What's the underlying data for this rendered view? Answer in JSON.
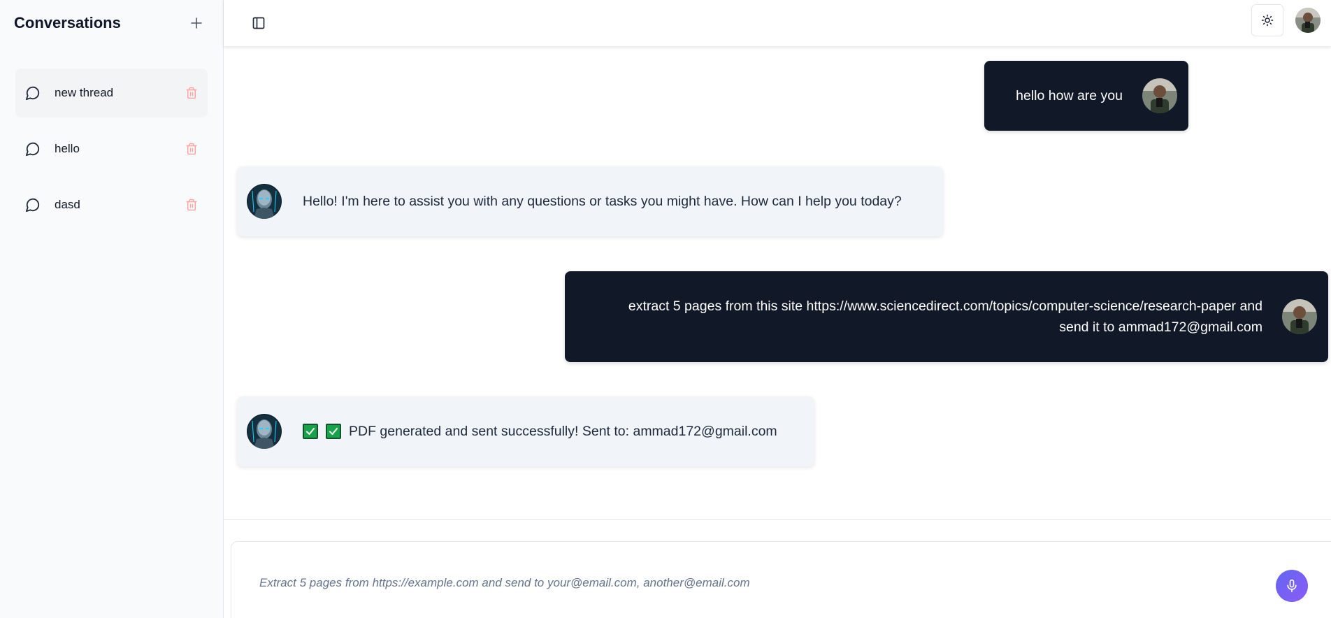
{
  "sidebar": {
    "title": "Conversations",
    "new_icon": "plus-icon",
    "threads": [
      {
        "label": "new thread",
        "icon": "chat-bubble-icon",
        "delete_icon": "trash-icon",
        "active": true
      },
      {
        "label": "hello",
        "icon": "chat-bubble-icon",
        "delete_icon": "trash-icon",
        "active": false
      },
      {
        "label": "dasd",
        "icon": "chat-bubble-icon",
        "delete_icon": "trash-icon",
        "active": false
      }
    ]
  },
  "topbar": {
    "panel_toggle_icon": "sidebar-toggle-icon",
    "theme_icon": "sun-icon",
    "avatar_icon": "user-avatar"
  },
  "messages": [
    {
      "role": "user",
      "text": "hello how are you"
    },
    {
      "role": "assistant",
      "text": "Hello! I'm here to assist you with any questions or tasks you might have. How can I help you today?"
    },
    {
      "role": "user",
      "text_line1": "extract 5 pages from this site https://www.sciencedirect.com/topics/computer-science/research-paper and",
      "text_line2": "send it to ammad172@gmail.com"
    },
    {
      "role": "assistant",
      "text": "PDF generated and sent successfully! Sent to: ammad172@gmail.com",
      "prefix_icons": [
        "check-box-icon",
        "check-box-icon"
      ]
    }
  ],
  "composer": {
    "placeholder": "Extract 5 pages from https://example.com and send to your@email.com, another@email.com",
    "value": "",
    "mic_icon": "microphone-icon"
  },
  "colors": {
    "user_bubble": "#111827",
    "assistant_bubble": "#f1f5f9",
    "delete": "#fca5a5",
    "mic_gradient_start": "#6366f1",
    "mic_gradient_end": "#8b5cf6",
    "check": "#16a34a"
  }
}
